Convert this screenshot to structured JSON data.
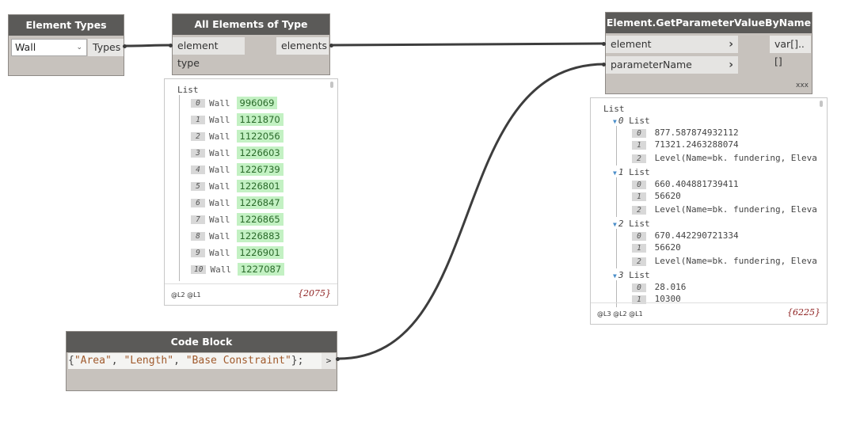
{
  "nodes": {
    "element_types": {
      "title": "Element Types",
      "selected": "Wall",
      "output": "Types"
    },
    "all_elements": {
      "title": "All Elements of Type",
      "input": "element type",
      "output": "elements",
      "preview": {
        "root": "List",
        "items": [
          {
            "i": "0",
            "label": "Wall",
            "id": "996069"
          },
          {
            "i": "1",
            "label": "Wall",
            "id": "1121870"
          },
          {
            "i": "2",
            "label": "Wall",
            "id": "1122056"
          },
          {
            "i": "3",
            "label": "Wall",
            "id": "1226603"
          },
          {
            "i": "4",
            "label": "Wall",
            "id": "1226739"
          },
          {
            "i": "5",
            "label": "Wall",
            "id": "1226801"
          },
          {
            "i": "6",
            "label": "Wall",
            "id": "1226847"
          },
          {
            "i": "7",
            "label": "Wall",
            "id": "1226865"
          },
          {
            "i": "8",
            "label": "Wall",
            "id": "1226883"
          },
          {
            "i": "9",
            "label": "Wall",
            "id": "1226901"
          },
          {
            "i": "10",
            "label": "Wall",
            "id": "1227087"
          }
        ],
        "levels": "@L2 @L1",
        "count": "{2075}"
      }
    },
    "get_param": {
      "title": "Element.GetParameterValueByName",
      "inputs": [
        "element",
        "parameterName"
      ],
      "output": "var[]..[]",
      "lacing": "xxx",
      "preview": {
        "root": "List",
        "groups": [
          {
            "i": "0",
            "label": "List",
            "items": [
              {
                "i": "0",
                "v": "877.587874932112"
              },
              {
                "i": "1",
                "v": "71321.2463288074"
              },
              {
                "i": "2",
                "v": "Level(Name=bk. fundering, Eleva"
              }
            ]
          },
          {
            "i": "1",
            "label": "List",
            "items": [
              {
                "i": "0",
                "v": "660.404881739411"
              },
              {
                "i": "1",
                "v": "56620"
              },
              {
                "i": "2",
                "v": "Level(Name=bk. fundering, Eleva"
              }
            ]
          },
          {
            "i": "2",
            "label": "List",
            "items": [
              {
                "i": "0",
                "v": "670.442290721334"
              },
              {
                "i": "1",
                "v": "56620"
              },
              {
                "i": "2",
                "v": "Level(Name=bk. fundering, Eleva"
              }
            ]
          },
          {
            "i": "3",
            "label": "List",
            "items": [
              {
                "i": "0",
                "v": "28.016"
              },
              {
                "i": "1",
                "v": "10300"
              }
            ]
          }
        ],
        "levels": "@L3 @L2 @L1",
        "count": "{6225}"
      }
    },
    "code_block": {
      "title": "Code Block",
      "code_open": "{",
      "s1": "\"Area\"",
      "sep1": ", ",
      "s2": "\"Length\"",
      "sep2": ", ",
      "s3": "\"Base Constraint\"",
      "code_close": "};",
      "output_glyph": ">"
    }
  }
}
